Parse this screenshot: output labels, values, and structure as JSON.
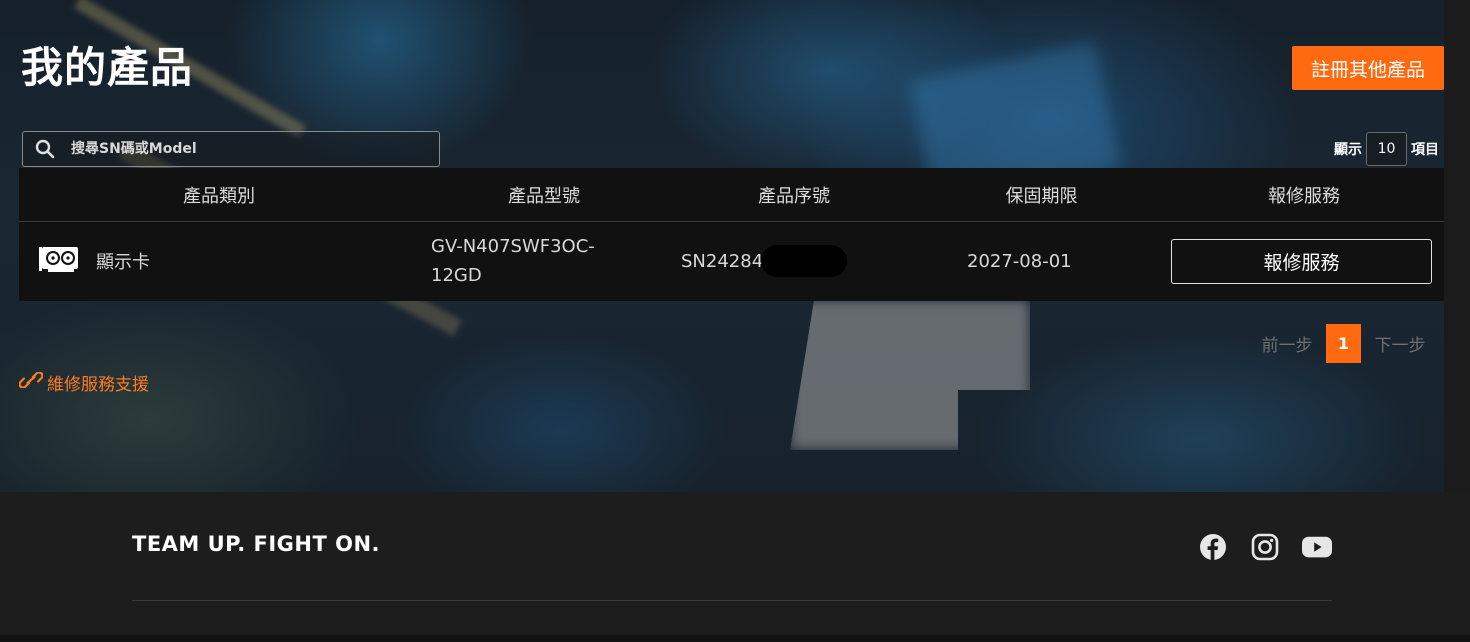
{
  "page": {
    "title": "我的產品",
    "register_button": "註冊其他產品"
  },
  "search": {
    "placeholder": "搜尋SN碼或Model"
  },
  "per_page": {
    "prefix": "顯示",
    "value": "10",
    "suffix": "項目"
  },
  "table": {
    "headers": [
      "產品類別",
      "產品型號",
      "產品序號",
      "保固期限",
      "報修服務"
    ],
    "rows": [
      {
        "category": "顯示卡",
        "model_line1": "GV-N407SWF3OC-",
        "model_line2": "12GD",
        "serial_visible": "SN24284",
        "warranty": "2027-08-01",
        "action": "報修服務"
      }
    ]
  },
  "pagination": {
    "prev": "前一步",
    "current": "1",
    "next": "下一步"
  },
  "support_link": "維修服務支援",
  "footer": {
    "slogan": "TEAM UP. FIGHT ON.",
    "social": [
      "facebook-icon",
      "instagram-icon",
      "youtube-icon"
    ]
  },
  "colors": {
    "accent": "#ff6a10",
    "table_bg": "#111111",
    "footer_bg": "#1d1d1d"
  }
}
